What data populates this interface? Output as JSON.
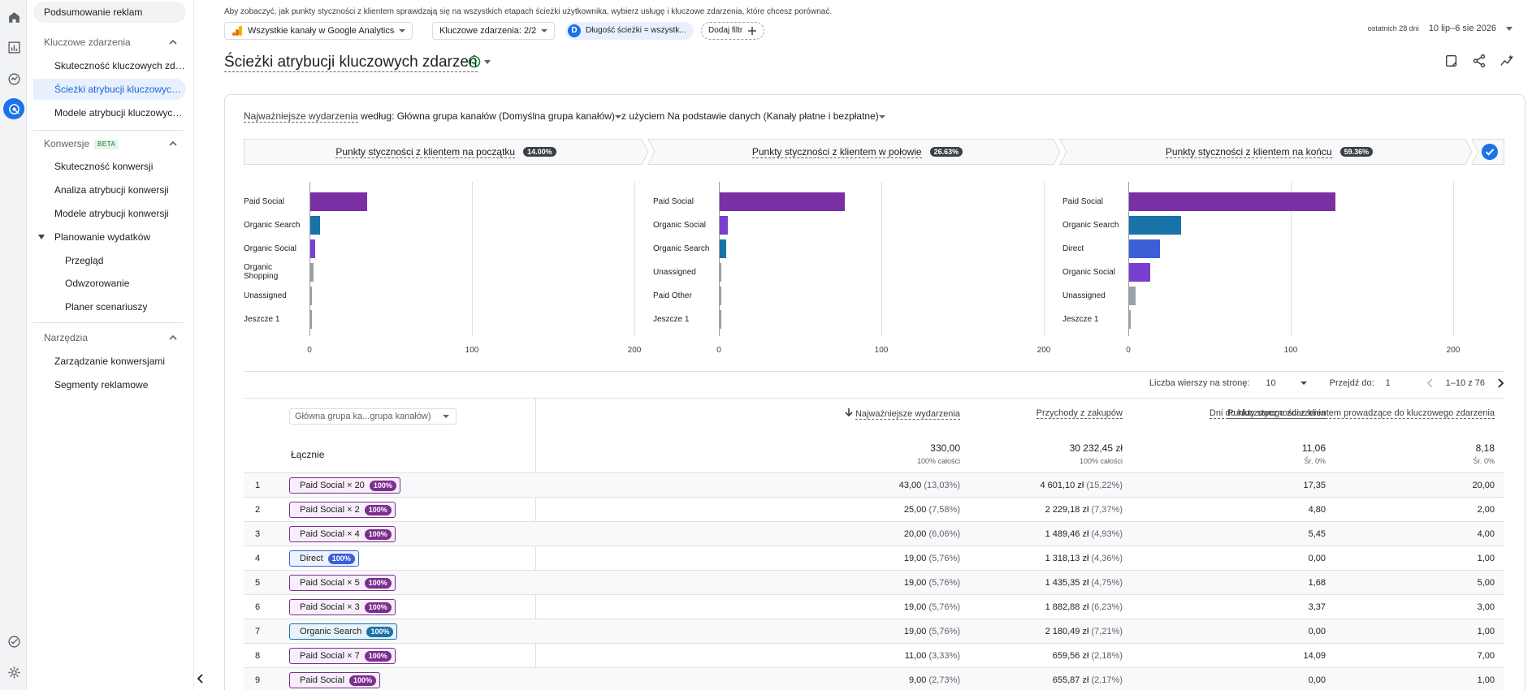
{
  "sidebar": {
    "top": "Podsumowanie reklam",
    "sections": [
      {
        "label": "Kluczowe zdarzenia"
      },
      {
        "label": "Konwersje",
        "badge": "BETA"
      },
      {
        "label": "Narzędzia"
      }
    ],
    "items": [
      {
        "label": "Skuteczność kluczowych zdarzeń"
      },
      {
        "label": "Ścieżki atrybucji kluczowych zdarzeń"
      },
      {
        "label": "Modele atrybucji kluczowych zdarzeń"
      },
      {
        "label": "Skuteczność konwersji"
      },
      {
        "label": "Analiza atrybucji konwersji"
      },
      {
        "label": "Modele atrybucji konwersji"
      },
      {
        "label": "Planowanie wydatków"
      },
      {
        "label": "Przegląd"
      },
      {
        "label": "Odwzorowanie"
      },
      {
        "label": "Planer scenariuszy"
      },
      {
        "label": "Zarządzanie konwersjami"
      },
      {
        "label": "Segmenty reklamowe"
      }
    ]
  },
  "header": {
    "hint": "Aby zobaczyć, jak punkty styczności z klientem sprawdzają się na wszystkich etapach ścieżki użytkownika, wybierz usługę i kluczowe zdarzenia, które chcesz porównać.",
    "property": "Wszystkie kanały w Google Analytics",
    "events": "Kluczowe zdarzenia: 2/2",
    "filter_initial": "D",
    "filter": "Długość ścieżki = wszystk...",
    "add_filter": "Dodaj filtr",
    "date_prefix": "ostatnich 28 dni",
    "date_range": "10 lip–6 sie 2026",
    "title": "Ścieżki atrybucji kluczowych zdarzeń"
  },
  "criteria": {
    "metric": "Najważniejsze wydarzenia",
    "by": " według: ",
    "dimension": "Główna grupa kanałów (Domyślna grupa kanałów)",
    "model_prefix": "z użyciem ",
    "model": "Na podstawie danych (Kanały płatne i bezpłatne)"
  },
  "steps": [
    {
      "label": "Punkty styczności z klientem na początku",
      "pct": "14.00%"
    },
    {
      "label": "Punkty styczności z klientem w połowie",
      "pct": "26.63%"
    },
    {
      "label": "Punkty styczności z klientem na końcu",
      "pct": "59.36%"
    }
  ],
  "chart_data": [
    {
      "type": "bar",
      "title": "Punkty styczności z klientem na początku",
      "categories": [
        "Paid Social",
        "Organic Search",
        "Organic Social",
        "Organic Shopping",
        "Unassigned",
        "Jeszcze 1"
      ],
      "values": [
        35,
        6,
        3,
        2,
        1,
        1
      ],
      "xlim": [
        0,
        200
      ],
      "ticks": [
        "0",
        "100",
        "200"
      ],
      "colors": [
        "#7b2fa5",
        "#1a73a8",
        "#7b3fd0",
        "#9aa0a6",
        "#9aa0a6",
        "#9aa0a6"
      ]
    },
    {
      "type": "bar",
      "title": "Punkty styczności z klientem w połowie",
      "categories": [
        "Paid Social",
        "Organic Social",
        "Organic Search",
        "Unassigned",
        "Paid Other",
        "Jeszcze 1"
      ],
      "values": [
        77,
        5,
        4,
        1,
        1,
        1
      ],
      "xlim": [
        0,
        200
      ],
      "ticks": [
        "0",
        "100",
        "200"
      ],
      "colors": [
        "#7b2fa5",
        "#7b3fd0",
        "#1a73a8",
        "#9aa0a6",
        "#9aa0a6",
        "#9aa0a6"
      ]
    },
    {
      "type": "bar",
      "title": "Punkty styczności z klientem na końcu",
      "categories": [
        "Paid Social",
        "Organic Search",
        "Direct",
        "Organic Social",
        "Unassigned",
        "Jeszcze 1"
      ],
      "values": [
        127,
        32,
        19,
        13,
        4,
        1
      ],
      "xlim": [
        0,
        200
      ],
      "ticks": [
        "0",
        "100",
        "200"
      ],
      "colors": [
        "#7b2fa5",
        "#1a73a8",
        "#3b5fd6",
        "#7b3fd0",
        "#9aa0a6",
        "#9aa0a6"
      ]
    }
  ],
  "pager": {
    "rows_label": "Liczba wierszy na stronę:",
    "rows": "10",
    "goto_label": "Przejdź do:",
    "goto": "1",
    "range": "1–10 z 76"
  },
  "table": {
    "dim_select": "Główna grupa ka...grupa kanałów)",
    "headers": [
      "Najważniejsze wydarzenia",
      "Przychody z zakupów",
      "Dni do kluczowego zdarzenia",
      "Punkty styczności z klientem prowadzące do kluczowego zdarzenia"
    ],
    "total_label": "Łącznie",
    "totals": [
      {
        "value": "330,00",
        "sub": "100% całości"
      },
      {
        "value": "30 232,45 zł",
        "sub": "100% całości"
      },
      {
        "value": "11,06",
        "sub": "Śr. 0%"
      },
      {
        "value": "8,18",
        "sub": "Śr. 0%"
      }
    ],
    "rows": [
      {
        "n": "1",
        "path": "Paid Social × 20",
        "badge": "100%",
        "kind": "social",
        "ev": "43,00",
        "evp": "(13,03%)",
        "rev": "4 601,10 zł",
        "revp": "(15,22%)",
        "days": "17,35",
        "tp": "20,00"
      },
      {
        "n": "2",
        "path": "Paid Social × 2",
        "badge": "100%",
        "kind": "social",
        "ev": "25,00",
        "evp": "(7,58%)",
        "rev": "2 229,18 zł",
        "revp": "(7,37%)",
        "days": "4,80",
        "tp": "2,00"
      },
      {
        "n": "3",
        "path": "Paid Social × 4",
        "badge": "100%",
        "kind": "social",
        "ev": "20,00",
        "evp": "(6,06%)",
        "rev": "1 489,46 zł",
        "revp": "(4,93%)",
        "days": "5,45",
        "tp": "4,00"
      },
      {
        "n": "4",
        "path": "Direct",
        "badge": "100%",
        "kind": "direct",
        "ev": "19,00",
        "evp": "(5,76%)",
        "rev": "1 318,13 zł",
        "revp": "(4,36%)",
        "days": "0,00",
        "tp": "1,00"
      },
      {
        "n": "5",
        "path": "Paid Social × 5",
        "badge": "100%",
        "kind": "social",
        "ev": "19,00",
        "evp": "(5,76%)",
        "rev": "1 435,35 zł",
        "revp": "(4,75%)",
        "days": "1,68",
        "tp": "5,00"
      },
      {
        "n": "6",
        "path": "Paid Social × 3",
        "badge": "100%",
        "kind": "social",
        "ev": "19,00",
        "evp": "(5,76%)",
        "rev": "1 882,88 zł",
        "revp": "(6,23%)",
        "days": "3,37",
        "tp": "3,00"
      },
      {
        "n": "7",
        "path": "Organic Search",
        "badge": "100%",
        "kind": "organic",
        "ev": "19,00",
        "evp": "(5,76%)",
        "rev": "2 180,49 zł",
        "revp": "(7,21%)",
        "days": "0,00",
        "tp": "1,00"
      },
      {
        "n": "8",
        "path": "Paid Social × 7",
        "badge": "100%",
        "kind": "social",
        "ev": "11,00",
        "evp": "(3,33%)",
        "rev": "659,56 zł",
        "revp": "(2,18%)",
        "days": "14,09",
        "tp": "7,00"
      },
      {
        "n": "9",
        "path": "Paid Social",
        "badge": "100%",
        "kind": "social",
        "ev": "9,00",
        "evp": "(2,73%)",
        "rev": "655,87 zł",
        "revp": "(2,17%)",
        "days": "0,00",
        "tp": "1,00"
      }
    ]
  }
}
